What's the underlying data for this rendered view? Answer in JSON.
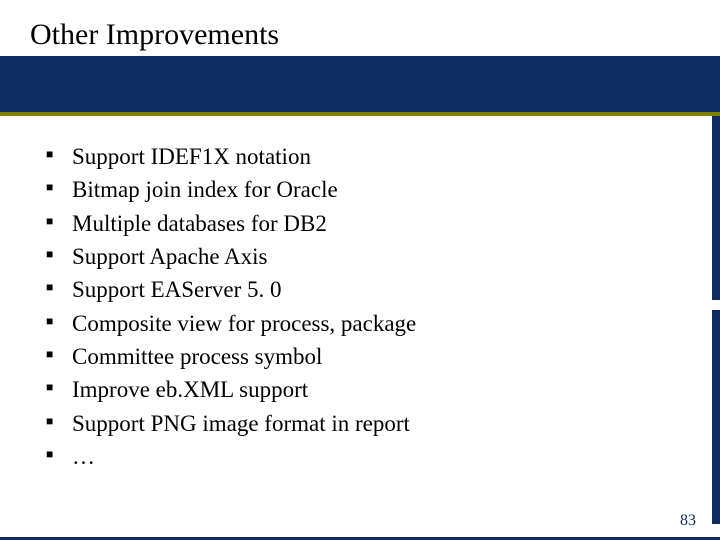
{
  "slide": {
    "title": "Other Improvements",
    "bullets": [
      "Support IDEF1X notation",
      "Bitmap join index for Oracle",
      "Multiple databases for DB2",
      "Support Apache Axis",
      "Support EAServer 5. 0",
      "Composite view for process, package",
      "Committee process symbol",
      "Improve eb.XML support",
      "Support PNG image format in report",
      "…"
    ],
    "page_number": "83"
  }
}
